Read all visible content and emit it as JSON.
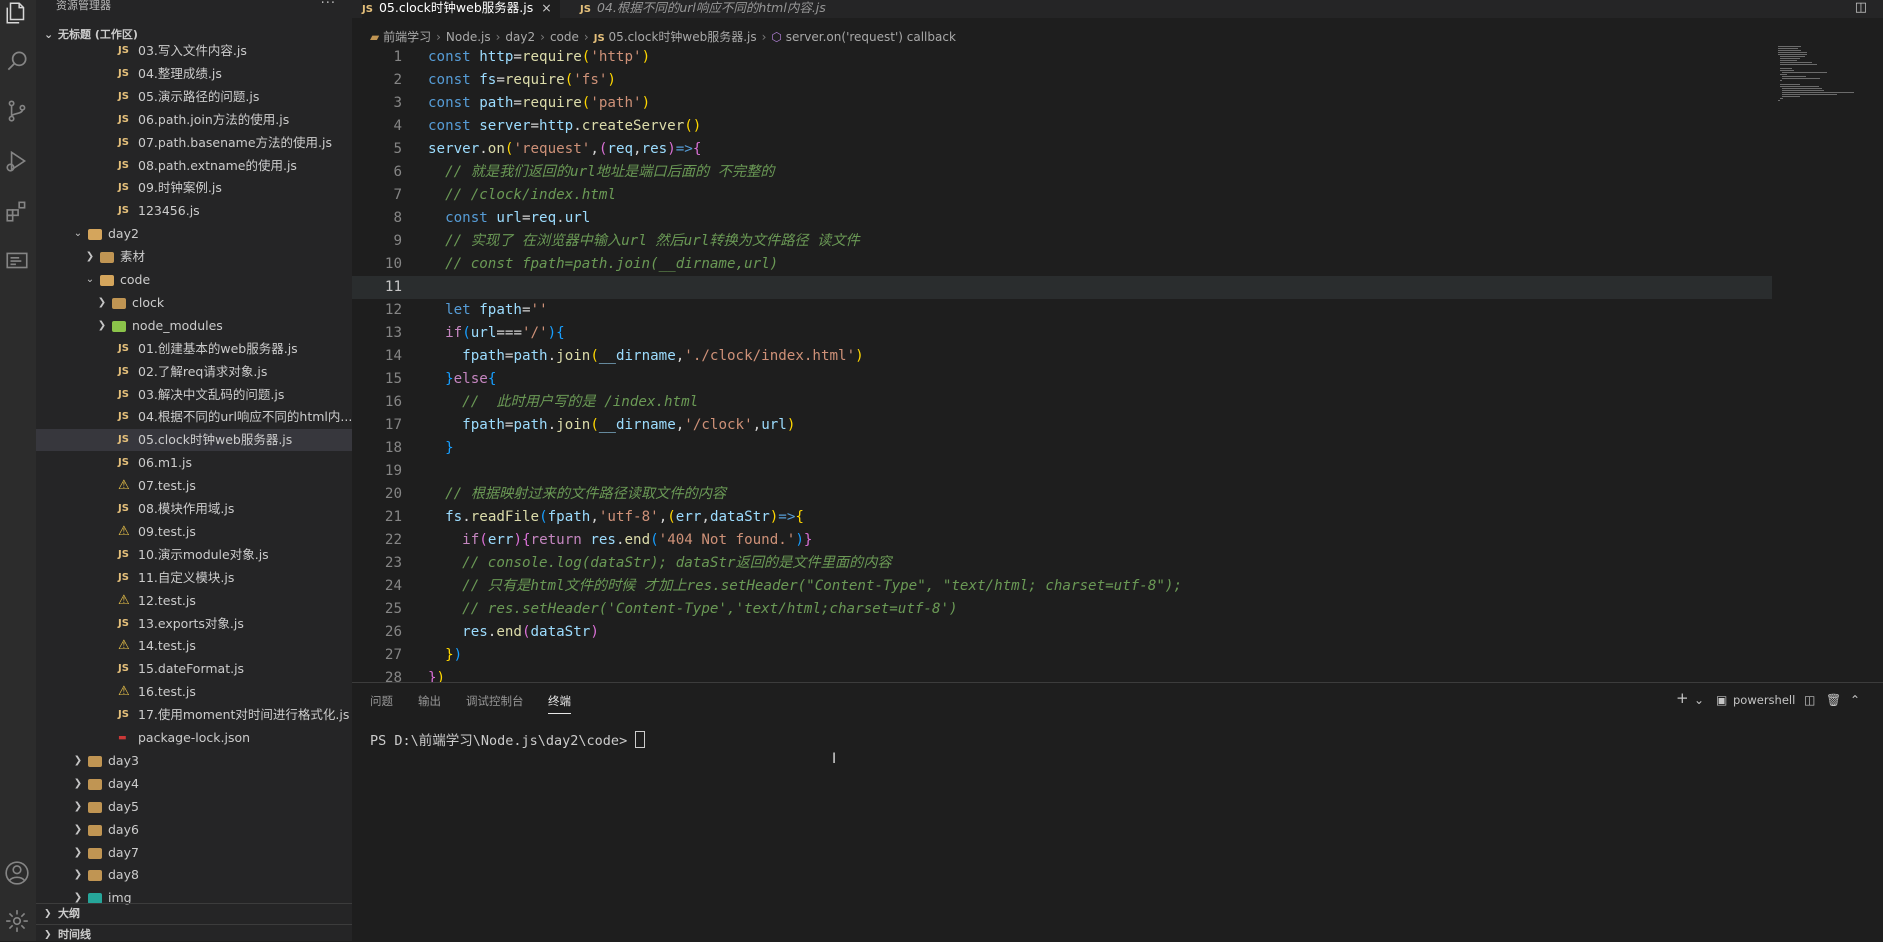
{
  "sidebar": {
    "header": "资源管理器",
    "workspace": "无标题 (工作区)",
    "tree": [
      {
        "label": "03.写入文件内容.js",
        "depth": 3,
        "kind": "js"
      },
      {
        "label": "04.整理成绩.js",
        "depth": 3,
        "kind": "js"
      },
      {
        "label": "05.演示路径的问题.js",
        "depth": 3,
        "kind": "js"
      },
      {
        "label": "06.path.join方法的使用.js",
        "depth": 3,
        "kind": "js"
      },
      {
        "label": "07.path.basename方法的使用.js",
        "depth": 3,
        "kind": "js"
      },
      {
        "label": "08.path.extname的使用.js",
        "depth": 3,
        "kind": "js"
      },
      {
        "label": "09.时钟案例.js",
        "depth": 3,
        "kind": "js"
      },
      {
        "label": "123456.js",
        "depth": 3,
        "kind": "js"
      },
      {
        "label": "day2",
        "depth": 1,
        "kind": "folder-open"
      },
      {
        "label": "素材",
        "depth": 2,
        "kind": "folder"
      },
      {
        "label": "code",
        "depth": 2,
        "kind": "folder-open"
      },
      {
        "label": "clock",
        "depth": 3,
        "kind": "folder"
      },
      {
        "label": "node_modules",
        "depth": 3,
        "kind": "node_modules"
      },
      {
        "label": "01.创建基本的web服务器.js",
        "depth": 3,
        "kind": "js"
      },
      {
        "label": "02.了解req请求对象.js",
        "depth": 3,
        "kind": "js"
      },
      {
        "label": "03.解决中文乱码的问题.js",
        "depth": 3,
        "kind": "js"
      },
      {
        "label": "04.根据不同的url响应不同的html内...",
        "depth": 3,
        "kind": "js"
      },
      {
        "label": "05.clock时钟web服务器.js",
        "depth": 3,
        "kind": "js",
        "selected": true
      },
      {
        "label": "06.m1.js",
        "depth": 3,
        "kind": "js"
      },
      {
        "label": "07.test.js",
        "depth": 3,
        "kind": "warn"
      },
      {
        "label": "08.模块作用域.js",
        "depth": 3,
        "kind": "js"
      },
      {
        "label": "09.test.js",
        "depth": 3,
        "kind": "warn"
      },
      {
        "label": "10.演示module对象.js",
        "depth": 3,
        "kind": "js"
      },
      {
        "label": "11.自定义模块.js",
        "depth": 3,
        "kind": "js"
      },
      {
        "label": "12.test.js",
        "depth": 3,
        "kind": "warn"
      },
      {
        "label": "13.exports对象.js",
        "depth": 3,
        "kind": "js"
      },
      {
        "label": "14.test.js",
        "depth": 3,
        "kind": "warn"
      },
      {
        "label": "15.dateFormat.js",
        "depth": 3,
        "kind": "js"
      },
      {
        "label": "16.test.js",
        "depth": 3,
        "kind": "warn"
      },
      {
        "label": "17.使用moment对时间进行格式化.js",
        "depth": 3,
        "kind": "js"
      },
      {
        "label": "package-lock.json",
        "depth": 3,
        "kind": "json"
      },
      {
        "label": "day3",
        "depth": 1,
        "kind": "folder"
      },
      {
        "label": "day4",
        "depth": 1,
        "kind": "folder"
      },
      {
        "label": "day5",
        "depth": 1,
        "kind": "folder"
      },
      {
        "label": "day6",
        "depth": 1,
        "kind": "folder"
      },
      {
        "label": "day7",
        "depth": 1,
        "kind": "folder"
      },
      {
        "label": "day8",
        "depth": 1,
        "kind": "folder"
      },
      {
        "label": "img",
        "depth": 1,
        "kind": "img"
      }
    ],
    "outline": "大纲",
    "timeline": "时间线"
  },
  "tabs": [
    {
      "label": "05.clock时钟web服务器.js",
      "active": true,
      "close": "×"
    },
    {
      "label": "04.根据不同的url响应不同的html内容.js",
      "active": false
    }
  ],
  "tab_js_badge": "JS",
  "breadcrumb": {
    "parts": [
      "前端学习",
      "Node.js",
      "day2",
      "code"
    ],
    "file": "05.clock时钟web服务器.js",
    "symbol": "server.on('request') callback"
  },
  "code_lines": [
    [
      [
        "k",
        "const "
      ],
      [
        "v",
        "http"
      ],
      [
        "o",
        "="
      ],
      [
        "f",
        "require"
      ],
      [
        "b1",
        "("
      ],
      [
        "s",
        "'http'"
      ],
      [
        "b1",
        ")"
      ]
    ],
    [
      [
        "k",
        "const "
      ],
      [
        "v",
        "fs"
      ],
      [
        "o",
        "="
      ],
      [
        "f",
        "require"
      ],
      [
        "b1",
        "("
      ],
      [
        "s",
        "'fs'"
      ],
      [
        "b1",
        ")"
      ]
    ],
    [
      [
        "k",
        "const "
      ],
      [
        "v",
        "path"
      ],
      [
        "o",
        "="
      ],
      [
        "f",
        "require"
      ],
      [
        "b1",
        "("
      ],
      [
        "s",
        "'path'"
      ],
      [
        "b1",
        ")"
      ]
    ],
    [
      [
        "k",
        "const "
      ],
      [
        "v",
        "server"
      ],
      [
        "o",
        "="
      ],
      [
        "v",
        "http"
      ],
      [
        "o",
        "."
      ],
      [
        "f",
        "createServer"
      ],
      [
        "b1",
        "()"
      ]
    ],
    [
      [
        "v",
        "server"
      ],
      [
        "o",
        "."
      ],
      [
        "f",
        "on"
      ],
      [
        "b1",
        "("
      ],
      [
        "s",
        "'request'"
      ],
      [
        "o",
        ","
      ],
      [
        "b2",
        "("
      ],
      [
        "v",
        "req"
      ],
      [
        "o",
        ","
      ],
      [
        "v",
        "res"
      ],
      [
        "b2",
        ")"
      ],
      [
        "k",
        "=>"
      ],
      [
        "b2",
        "{"
      ]
    ],
    [
      [
        "o",
        "  "
      ],
      [
        "c",
        "// 就是我们返回的url地址是端口后面的 不完整的"
      ]
    ],
    [
      [
        "o",
        "  "
      ],
      [
        "c",
        "// /clock/index.html"
      ]
    ],
    [
      [
        "o",
        "  "
      ],
      [
        "k",
        "const "
      ],
      [
        "v",
        "url"
      ],
      [
        "o",
        "="
      ],
      [
        "v",
        "req"
      ],
      [
        "o",
        "."
      ],
      [
        "v",
        "url"
      ]
    ],
    [
      [
        "o",
        "  "
      ],
      [
        "c",
        "// 实现了 在浏览器中输入url 然后url转换为文件路径 读文件"
      ]
    ],
    [
      [
        "o",
        "  "
      ],
      [
        "c",
        "// const fpath=path.join(__dirname,url)"
      ]
    ],
    [],
    [
      [
        "o",
        "  "
      ],
      [
        "k",
        "let "
      ],
      [
        "v",
        "fpath"
      ],
      [
        "o",
        "="
      ],
      [
        "s",
        "''"
      ]
    ],
    [
      [
        "o",
        "  "
      ],
      [
        "kw",
        "if"
      ],
      [
        "b3",
        "("
      ],
      [
        "v",
        "url"
      ],
      [
        "o",
        "==="
      ],
      [
        "s",
        "'/'"
      ],
      [
        "b3",
        ")"
      ],
      [
        "b3",
        "{"
      ]
    ],
    [
      [
        "o",
        "    "
      ],
      [
        "v",
        "fpath"
      ],
      [
        "o",
        "="
      ],
      [
        "v",
        "path"
      ],
      [
        "o",
        "."
      ],
      [
        "f",
        "join"
      ],
      [
        "b1",
        "("
      ],
      [
        "v",
        "__dirname"
      ],
      [
        "o",
        ","
      ],
      [
        "s",
        "'./clock/index.html'"
      ],
      [
        "b1",
        ")"
      ]
    ],
    [
      [
        "o",
        "  "
      ],
      [
        "b3",
        "}"
      ],
      [
        "kw",
        "else"
      ],
      [
        "b3",
        "{"
      ]
    ],
    [
      [
        "o",
        "    "
      ],
      [
        "c",
        "//  此时用户写的是 /index.html"
      ]
    ],
    [
      [
        "o",
        "    "
      ],
      [
        "v",
        "fpath"
      ],
      [
        "o",
        "="
      ],
      [
        "v",
        "path"
      ],
      [
        "o",
        "."
      ],
      [
        "f",
        "join"
      ],
      [
        "b1",
        "("
      ],
      [
        "v",
        "__dirname"
      ],
      [
        "o",
        ","
      ],
      [
        "s",
        "'/clock'"
      ],
      [
        "o",
        ","
      ],
      [
        "v",
        "url"
      ],
      [
        "b1",
        ")"
      ]
    ],
    [
      [
        "o",
        "  "
      ],
      [
        "b3",
        "}"
      ]
    ],
    [],
    [
      [
        "o",
        "  "
      ],
      [
        "c",
        "// 根据映射过来的文件路径读取文件的内容"
      ]
    ],
    [
      [
        "o",
        "  "
      ],
      [
        "v",
        "fs"
      ],
      [
        "o",
        "."
      ],
      [
        "f",
        "readFile"
      ],
      [
        "b3",
        "("
      ],
      [
        "v",
        "fpath"
      ],
      [
        "o",
        ","
      ],
      [
        "s",
        "'utf-8'"
      ],
      [
        "o",
        ","
      ],
      [
        "b1",
        "("
      ],
      [
        "v",
        "err"
      ],
      [
        "o",
        ","
      ],
      [
        "v",
        "dataStr"
      ],
      [
        "b1",
        ")"
      ],
      [
        "k",
        "=>"
      ],
      [
        "b1",
        "{"
      ]
    ],
    [
      [
        "o",
        "    "
      ],
      [
        "kw",
        "if"
      ],
      [
        "b2",
        "("
      ],
      [
        "v",
        "err"
      ],
      [
        "b2",
        ")"
      ],
      [
        "b2",
        "{"
      ],
      [
        "kw",
        "return "
      ],
      [
        "v",
        "res"
      ],
      [
        "o",
        "."
      ],
      [
        "f",
        "end"
      ],
      [
        "b3",
        "("
      ],
      [
        "s",
        "'404 Not found.'"
      ],
      [
        "b3",
        ")"
      ],
      [
        "b2",
        "}"
      ]
    ],
    [
      [
        "o",
        "    "
      ],
      [
        "c",
        "// console.log(dataStr); dataStr返回的是文件里面的内容"
      ]
    ],
    [
      [
        "o",
        "    "
      ],
      [
        "c",
        "// 只有是html文件的时候 才加上res.setHeader(\"Content-Type\", \"text/html; charset=utf-8\");"
      ]
    ],
    [
      [
        "o",
        "    "
      ],
      [
        "c",
        "// res.setHeader('Content-Type','text/html;charset=utf-8')"
      ]
    ],
    [
      [
        "o",
        "    "
      ],
      [
        "v",
        "res"
      ],
      [
        "o",
        "."
      ],
      [
        "f",
        "end"
      ],
      [
        "b2",
        "("
      ],
      [
        "v",
        "dataStr"
      ],
      [
        "b2",
        ")"
      ]
    ],
    [
      [
        "o",
        "  "
      ],
      [
        "b1",
        "}"
      ],
      [
        "b3",
        ")"
      ]
    ],
    [
      [
        "b2",
        "}"
      ],
      [
        "b1",
        ")"
      ]
    ]
  ],
  "current_line": 11,
  "panel": {
    "tabs": [
      "问题",
      "输出",
      "调试控制台",
      "终端"
    ],
    "active_tab": "终端",
    "terminal_name": "powershell",
    "prompt": "PS D:\\前端学习\\Node.js\\day2\\code> "
  },
  "icons": {
    "explorer": "files-icon",
    "search": "search-icon",
    "scm": "source-control-icon",
    "debug": "run-debug-icon",
    "extensions": "extensions-icon",
    "remote": "remote-explorer-icon",
    "account": "account-icon",
    "settings": "gear-icon"
  },
  "colors": {
    "accent": "#007acc",
    "selection": "#37373d",
    "editor_bg": "#1e1e1e",
    "sidebar_bg": "#252526"
  }
}
